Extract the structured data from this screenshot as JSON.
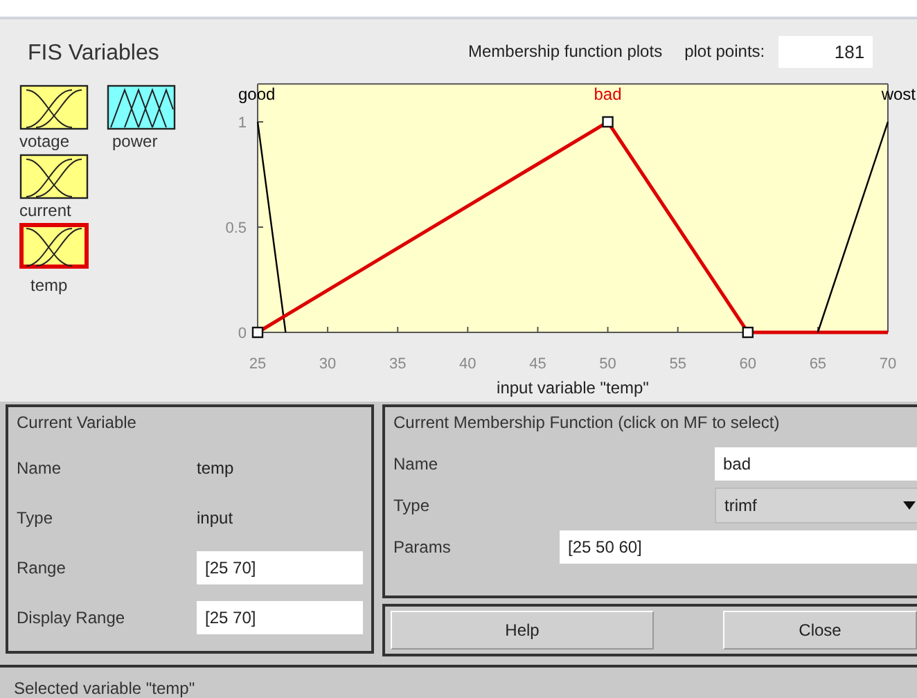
{
  "fis_variables": {
    "title": "FIS Variables",
    "items": [
      {
        "name": "votage",
        "kind": "input",
        "selected": false
      },
      {
        "name": "power",
        "kind": "output",
        "selected": false
      },
      {
        "name": "current",
        "kind": "input",
        "selected": false
      },
      {
        "name": "temp",
        "kind": "input",
        "selected": true
      }
    ]
  },
  "plot_header": {
    "title": "Membership function plots",
    "plot_points_label": "plot points:",
    "plot_points": "181"
  },
  "membership_functions": [
    {
      "selected": false
    },
    {
      "selected": true
    },
    {
      "selected": false
    }
  ],
  "chart_data": {
    "type": "line",
    "xlabel": "input variable \"temp\"",
    "x": [
      25,
      27,
      50,
      60,
      65,
      70
    ],
    "xlim": [
      25,
      70
    ],
    "ylim": [
      0,
      1.18
    ],
    "xticks": [
      25,
      30,
      35,
      40,
      45,
      50,
      55,
      60,
      65,
      70
    ],
    "yticks": [
      0,
      0.5,
      1
    ],
    "series": [
      {
        "name": "good",
        "color": "#000000",
        "values": [
          1,
          0,
          null,
          null,
          null,
          null
        ]
      },
      {
        "name": "bad",
        "color": "#dd0000",
        "values": [
          0,
          0.08,
          1,
          0,
          0,
          0
        ]
      },
      {
        "name": "wost",
        "color": "#000000",
        "values": [
          null,
          null,
          null,
          null,
          0,
          1
        ]
      }
    ]
  },
  "current_variable": {
    "title": "Current Variable",
    "rows": [
      {
        "label": "Name",
        "value": "temp",
        "kind": "text"
      },
      {
        "label": "Type",
        "value": "input",
        "kind": "text"
      },
      {
        "label": "Range",
        "value": "[25 70]",
        "kind": "field"
      },
      {
        "label": "Display Range",
        "value": "[25 70]",
        "kind": "field"
      }
    ]
  },
  "current_mf": {
    "title": "Current Membership Function (click on MF to select)",
    "name_label": "Name",
    "name": "bad",
    "type_label": "Type",
    "type": "trimf",
    "params_label": "Params",
    "params": "[25 50 60]"
  },
  "buttons": [
    "Help",
    "Close"
  ],
  "status_bar": "Selected variable \"temp\""
}
